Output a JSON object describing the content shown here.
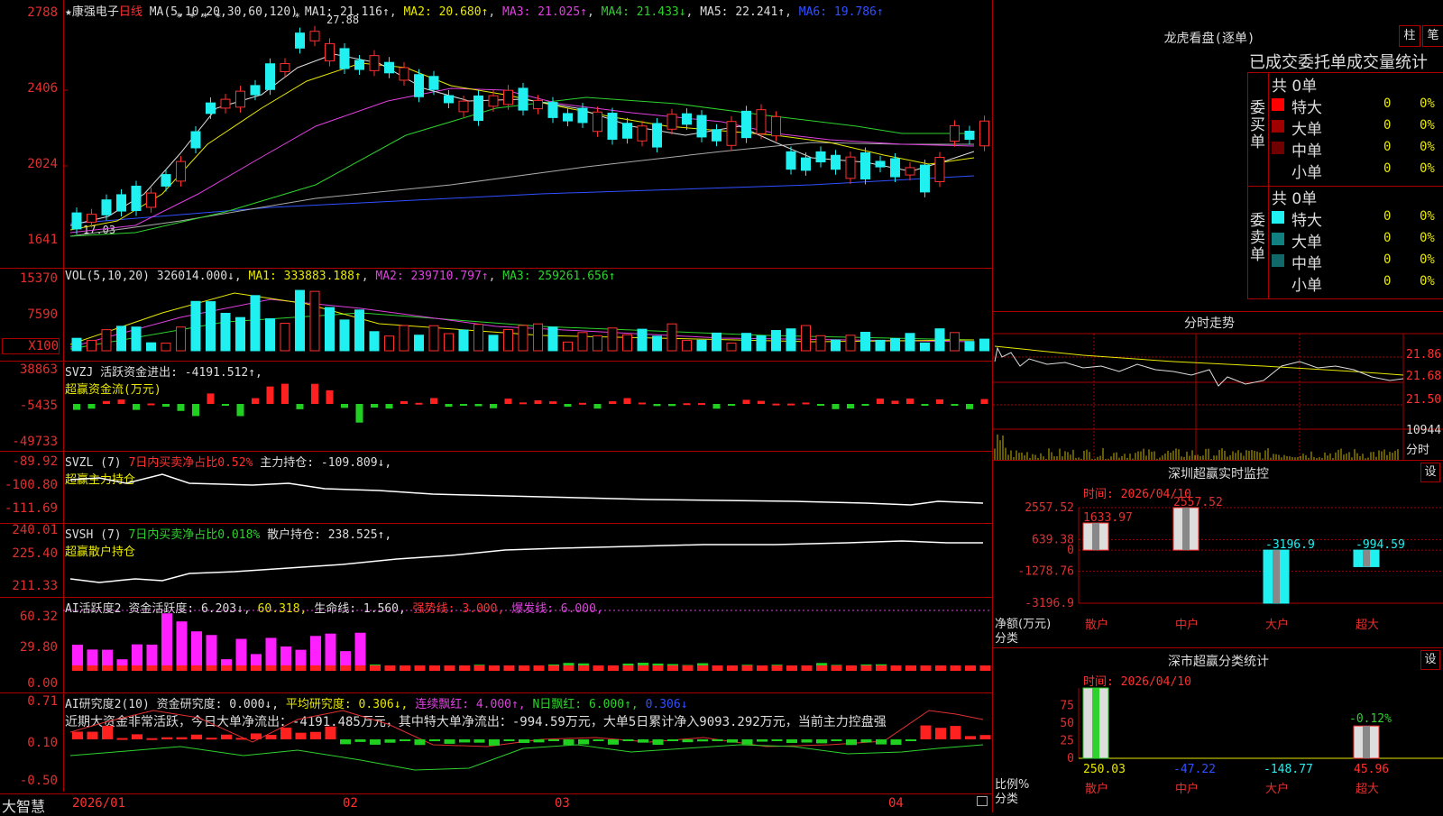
{
  "stock": {
    "star": "★",
    "name": "康强电子",
    "period": "日线"
  },
  "kline": {
    "ma_header": {
      "label": "MA(5,10,20,30,60,120)",
      "ma1": "MA1: 21.116↑",
      "ma2": "MA2: 20.680↑",
      "ma3": "MA3: 21.025↑",
      "ma4": "MA4: 21.433↓",
      "ma5": "MA5: 22.241↑",
      "ma6": "MA6: 19.786↑"
    },
    "y_ticks": [
      "2788",
      "2406",
      "2024",
      "1641"
    ],
    "high_label": "27.88",
    "low_label": "17.03",
    "stars": "* * * *",
    "star2": "*"
  },
  "vol": {
    "header": {
      "label": "VOL(5,10,20)",
      "v": "326014.000↓",
      "ma1": "MA1: 333883.188↑",
      "ma2": "MA2: 239710.797↑",
      "ma3": "MA3: 259261.656↑"
    },
    "y_ticks": [
      "15370",
      "7590",
      "X100"
    ]
  },
  "svzj": {
    "header": {
      "a": "SVZJ  活跃资金进出: -4191.512↑,",
      "b": "超赢资金流(万元)"
    },
    "y_ticks": [
      "38863",
      "-5435",
      "-49733"
    ]
  },
  "svzl": {
    "header": {
      "a": "SVZL (7)",
      "b": "7日内买卖净占比0.52%",
      "c": "主力持仓: -109.809↓,",
      "d": "超赢主力持仓"
    },
    "y_ticks": [
      "-89.92",
      "-100.80",
      "-111.69"
    ]
  },
  "svsh": {
    "header": {
      "a": "SVSH (7)",
      "b": "7日内买卖净占比0.018%",
      "c": "散户持仓: 238.525↑,",
      "d": "超赢散户持仓"
    },
    "y_ticks": [
      "240.01",
      "225.40",
      "211.33"
    ]
  },
  "ai1": {
    "header": {
      "a": "AI活跃度2",
      "b": "资金活跃度: 6.203↓",
      "c": "60.318,",
      "d": "生命线: 1.560,",
      "e": "强势线: 3.000,",
      "f": "爆发线: 6.000,"
    },
    "y_ticks": [
      "60.32",
      "29.80",
      "0.00"
    ]
  },
  "ai2": {
    "header": {
      "a": "AI研究度2(10)",
      "b": "资金研究度: 0.000↓,",
      "c": "平均研究度: 0.306↓,",
      "d": "连续飘红: 4.000↑,",
      "e": "N日飘红: 6.000↑,",
      "f": "0.306↓"
    },
    "comment": "近期大资金非常活跃，今日大单净流出：-4191.485万元，其中特大单净流出：-994.59万元，大单5日累计净入9093.292万元，当前主力控盘强",
    "y_ticks": [
      "0.71",
      "0.10",
      "-0.50"
    ]
  },
  "xaxis": {
    "brand": "大智慧",
    "labels": [
      "2026/01",
      "02",
      "03",
      "04"
    ]
  },
  "longhu": {
    "title": "龙虎看盘(逐单)",
    "btn_zhu": "柱",
    "btn_bi": "笔",
    "subtitle": "已成交委托单成交量统计",
    "buy": {
      "side": "委买单",
      "total": "共 0单",
      "rows": [
        {
          "name": "特大",
          "n": "0",
          "p": "0%",
          "color": "#ff0000"
        },
        {
          "name": "大单",
          "n": "0",
          "p": "0%",
          "color": "#a00000"
        },
        {
          "name": "中单",
          "n": "0",
          "p": "0%",
          "color": "#700000"
        },
        {
          "name": "小单",
          "n": "0",
          "p": "0%",
          "color": "#000000"
        }
      ]
    },
    "sell": {
      "side": "委卖单",
      "total": "共 0单",
      "rows": [
        {
          "name": "特大",
          "n": "0",
          "p": "0%",
          "color": "#20f0f0"
        },
        {
          "name": "大单",
          "n": "0",
          "p": "0%",
          "color": "#108080"
        },
        {
          "name": "中单",
          "n": "0",
          "p": "0%",
          "color": "#106868"
        },
        {
          "name": "小单",
          "n": "0",
          "p": "0%",
          "color": "#000000"
        }
      ]
    }
  },
  "intraday": {
    "title": "分时走势",
    "prices": [
      "21.86",
      "21.68",
      "21.50"
    ],
    "vol": "10944",
    "footer": "分时"
  },
  "monitor": {
    "title": "深圳超赢实时监控",
    "btn": "设",
    "time": "时间: 2026/04/10",
    "y_ticks": [
      "2557.52",
      "639.38",
      "0",
      "-1278.76",
      "-3196.9"
    ],
    "ylabel": "净额(万元)",
    "xlabel": "分类",
    "categories": [
      "散户",
      "中户",
      "大户",
      "超大"
    ],
    "values": [
      1633.97,
      2557.52,
      -3196.9,
      -994.59
    ],
    "value_labels": [
      "1633.97",
      "2557.52",
      "-3196.9",
      "-994.59"
    ]
  },
  "classify": {
    "title": "深市超赢分类统计",
    "btn": "设",
    "time": "时间: 2026/04/10",
    "y_ticks": [
      "75",
      "50",
      "25",
      "0"
    ],
    "ylabel": "比例%",
    "xlabel": "分类",
    "categories": [
      "散户",
      "中户",
      "大户",
      "超大"
    ],
    "values": [
      250.03,
      -47.22,
      -148.77,
      45.96
    ],
    "value_labels": [
      "250.03",
      "-47.22",
      "-148.77",
      "45.96"
    ],
    "top_label": "-0.12%"
  }
}
